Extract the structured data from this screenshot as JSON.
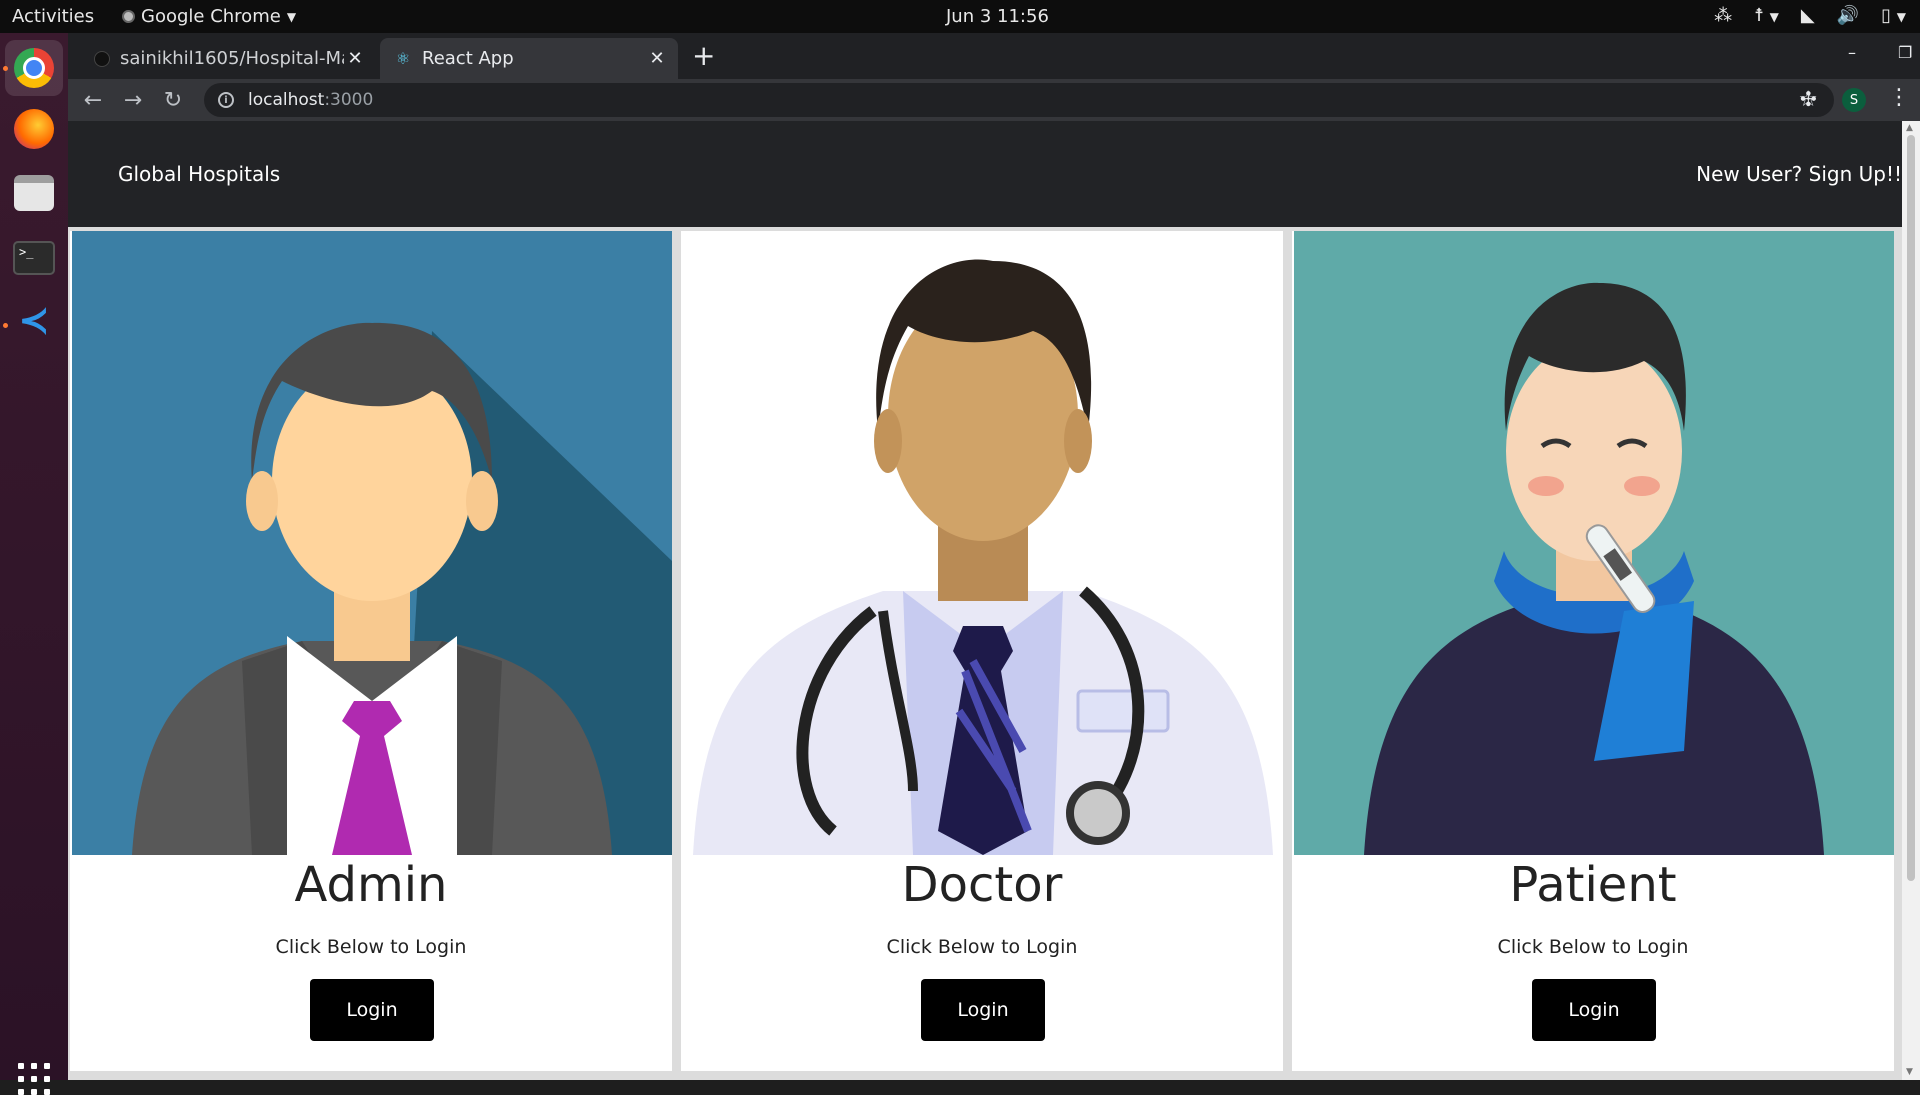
{
  "system": {
    "activities": "Activities",
    "app_name": "Google Chrome",
    "clock": "Jun 3  11:56"
  },
  "browser": {
    "tabs": [
      {
        "label": "sainikhil1605/Hospital-Ma",
        "active": false,
        "icon": "github-icon"
      },
      {
        "label": "React App",
        "active": true,
        "icon": "react-icon"
      }
    ],
    "url_host": "localhost",
    "url_port": ":3000",
    "profile_initial": "S"
  },
  "site": {
    "brand": "Global Hospitals",
    "signup": "New User? Sign Up!!"
  },
  "cards": [
    {
      "title": "Admin",
      "subtitle": "Click Below to Login",
      "button": "Login",
      "bg": "#2e6f92"
    },
    {
      "title": "Doctor",
      "subtitle": "Click Below to Login",
      "button": "Login",
      "bg": "#ffffff"
    },
    {
      "title": "Patient",
      "subtitle": "Click Below to Login",
      "button": "Login",
      "bg": "#5faaa8"
    }
  ],
  "colors": {
    "navbar": "#222326",
    "button": "#000000",
    "chrome_dark": "#202124",
    "chrome_toolbar": "#35363a"
  }
}
